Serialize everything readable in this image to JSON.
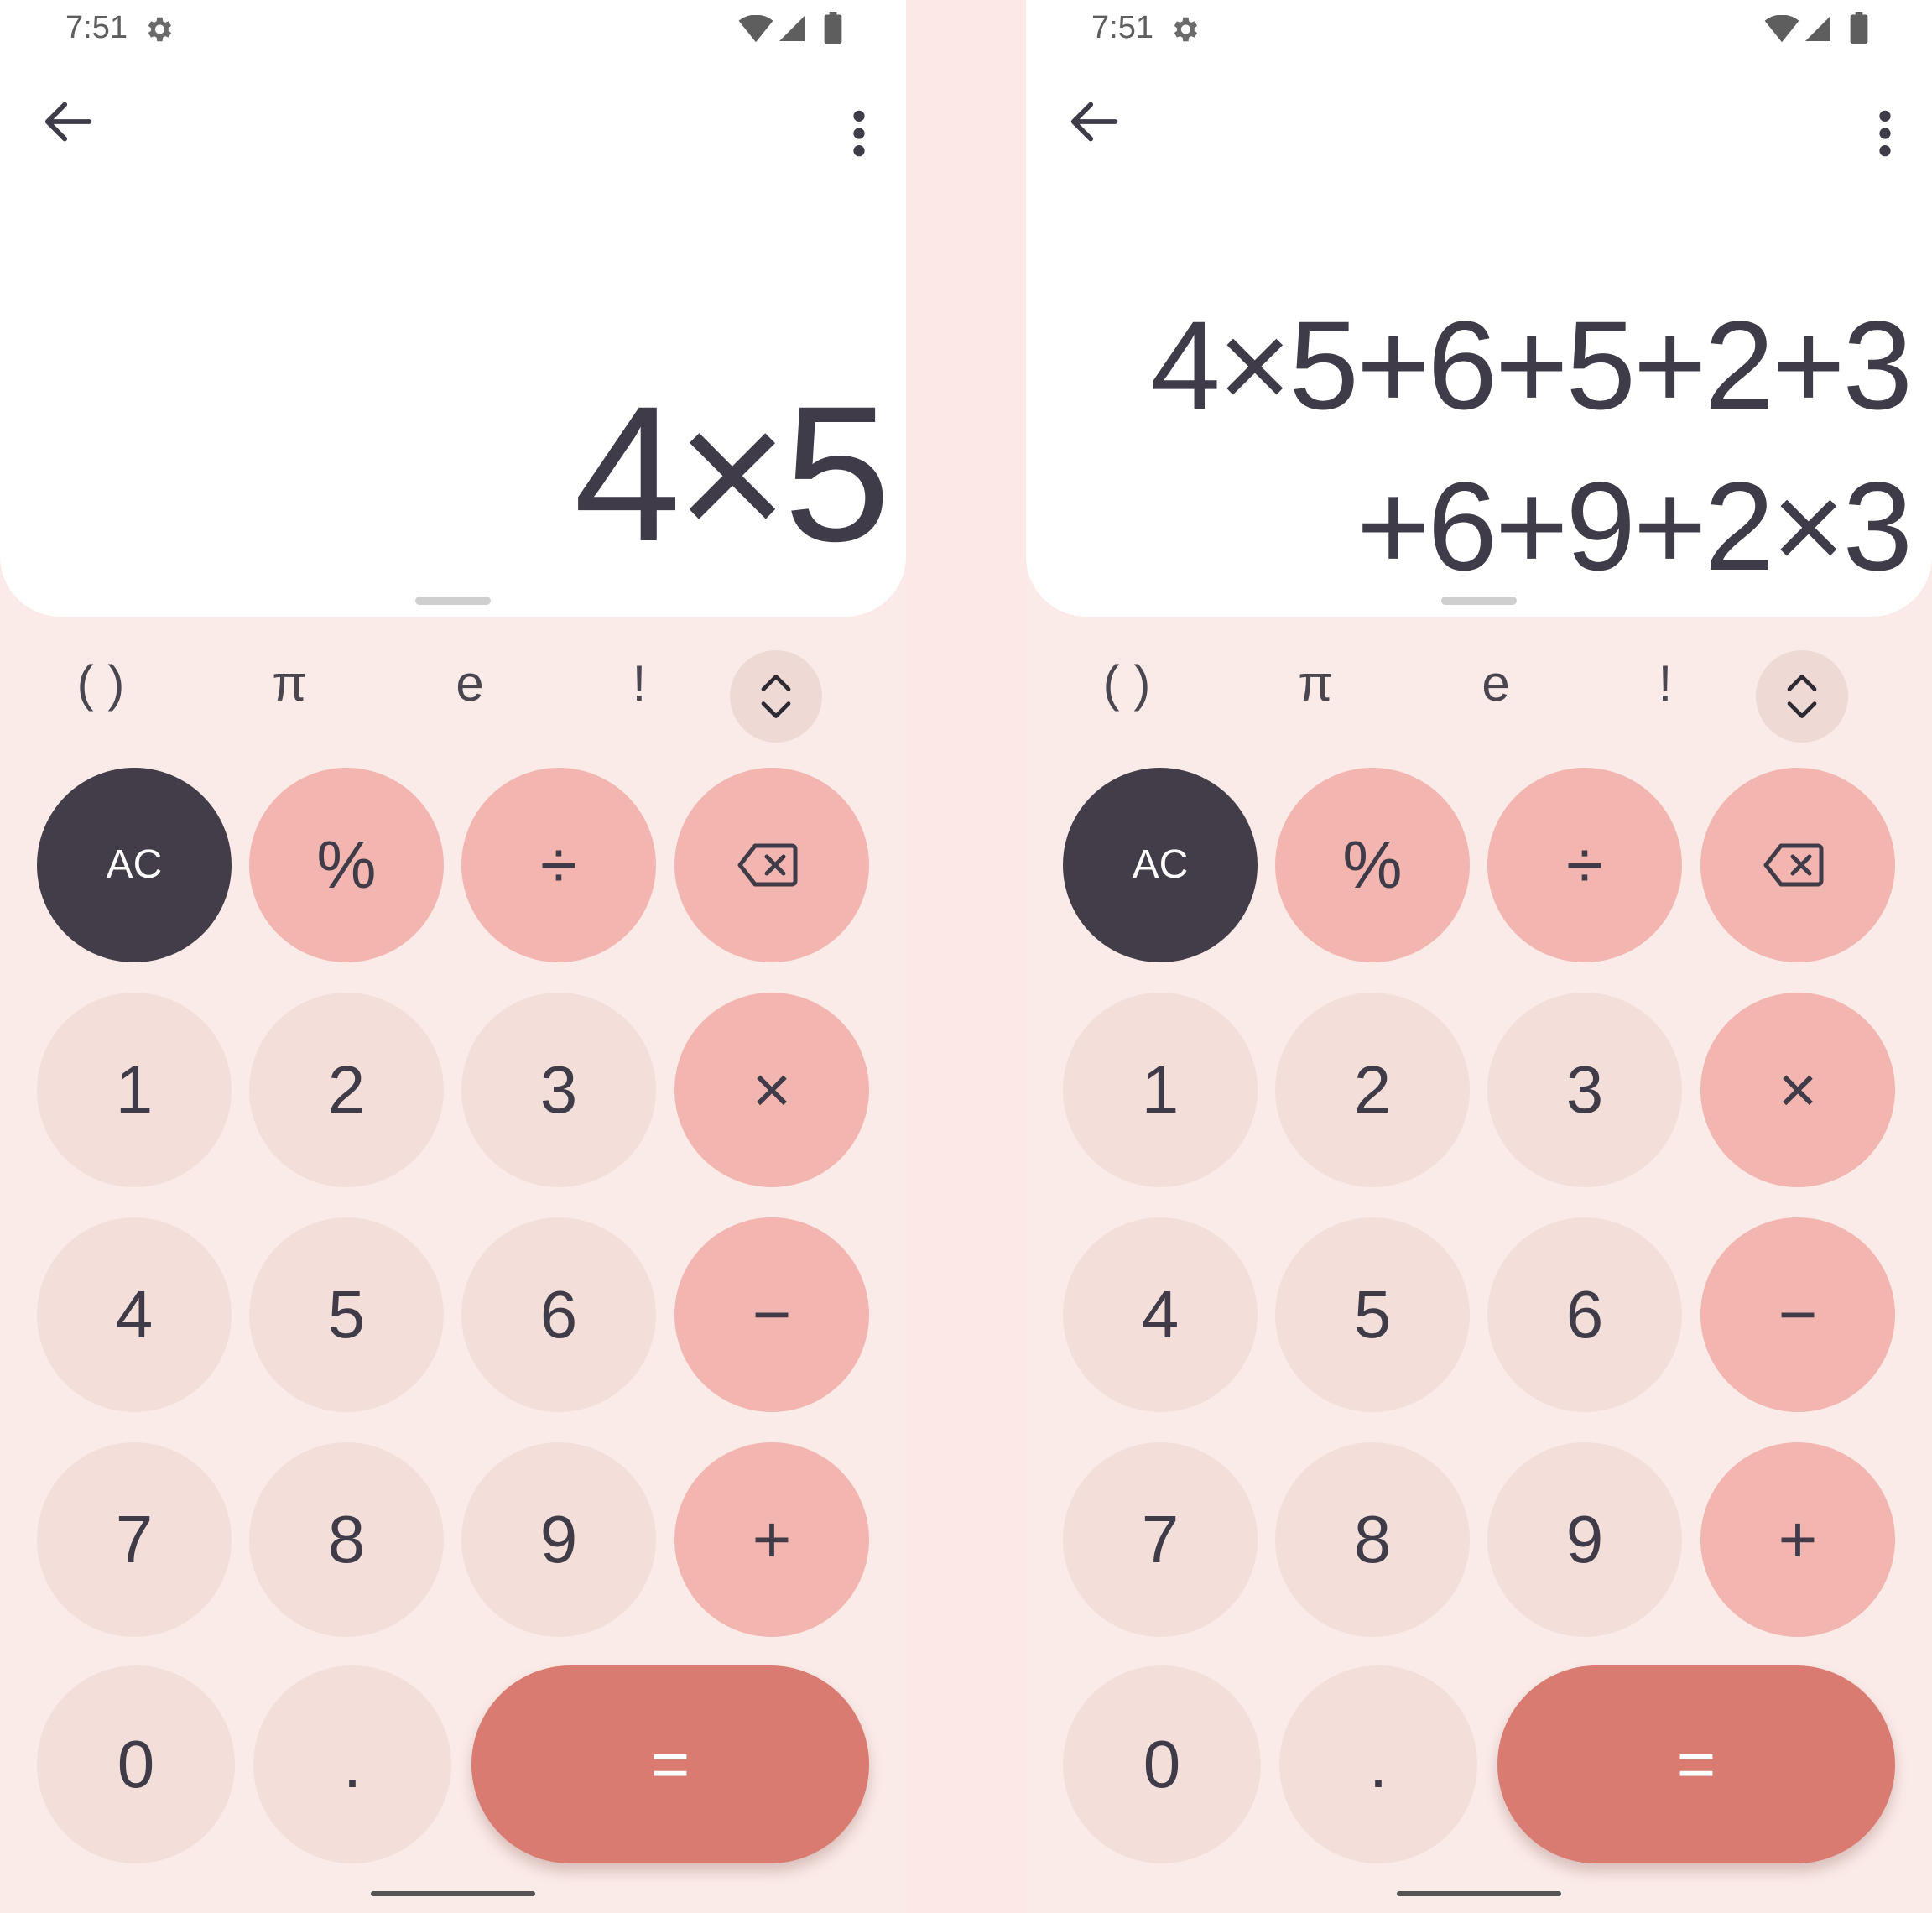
{
  "status_bar": {
    "time": "7:51",
    "icons": [
      "settings-gear-icon",
      "wifi-icon",
      "cellular-signal-icon",
      "battery-icon"
    ]
  },
  "toolbar": {
    "back_icon": "back-arrow-icon",
    "menu_icon": "more-vertical-icon"
  },
  "screens": [
    {
      "expression_lines": [
        "4×5"
      ]
    },
    {
      "expression_lines": [
        "4×5+6+5+2+3",
        "+6+9+2×3"
      ]
    }
  ],
  "scientific_row": {
    "parentheses": "( )",
    "pi": "π",
    "e": "e",
    "factorial": "!",
    "expand_icon": "expand-collapse-icon"
  },
  "keypad": {
    "ac": "AC",
    "percent": "%",
    "divide": "÷",
    "backspace_icon": "backspace-icon",
    "one": "1",
    "two": "2",
    "three": "3",
    "multiply": "×",
    "four": "4",
    "five": "5",
    "six": "6",
    "minus": "−",
    "seven": "7",
    "eight": "8",
    "nine": "9",
    "plus": "+",
    "zero": "0",
    "decimal": ".",
    "equals": "="
  },
  "colors": {
    "background": "#fbebe8",
    "display": "#ffffff",
    "number_key": "#f3ded9",
    "operator_key": "#f3b5b0",
    "ac_key": "#423d49",
    "equals_key": "#d97b71",
    "text": "#3f3b48"
  }
}
